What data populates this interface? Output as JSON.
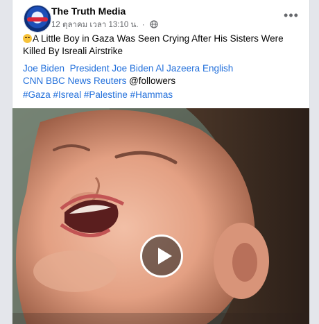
{
  "post": {
    "page_name": "The Truth Media",
    "timestamp": "12 ตุลาคม เวลา 13:10 น.",
    "dot": "·",
    "more_label": "•••",
    "text": "A Little Boy in Gaza Was Seen Crying After His Sisters Were Killed By Isreali Airstrike",
    "emoji": "crying-face-emoji",
    "tags_line1": [
      "Joe Biden",
      "President Joe Biden",
      "Al Jazeera English"
    ],
    "tags_line2": [
      "CNN",
      "BBC News",
      "Reuters"
    ],
    "followers_mention": "@followers",
    "hashtags": [
      "#Gaza",
      "#Isreal",
      "#Palestine",
      "#Hammas"
    ]
  },
  "colors": {
    "link": "#216fdb",
    "meta": "#65676b",
    "text": "#050505"
  }
}
